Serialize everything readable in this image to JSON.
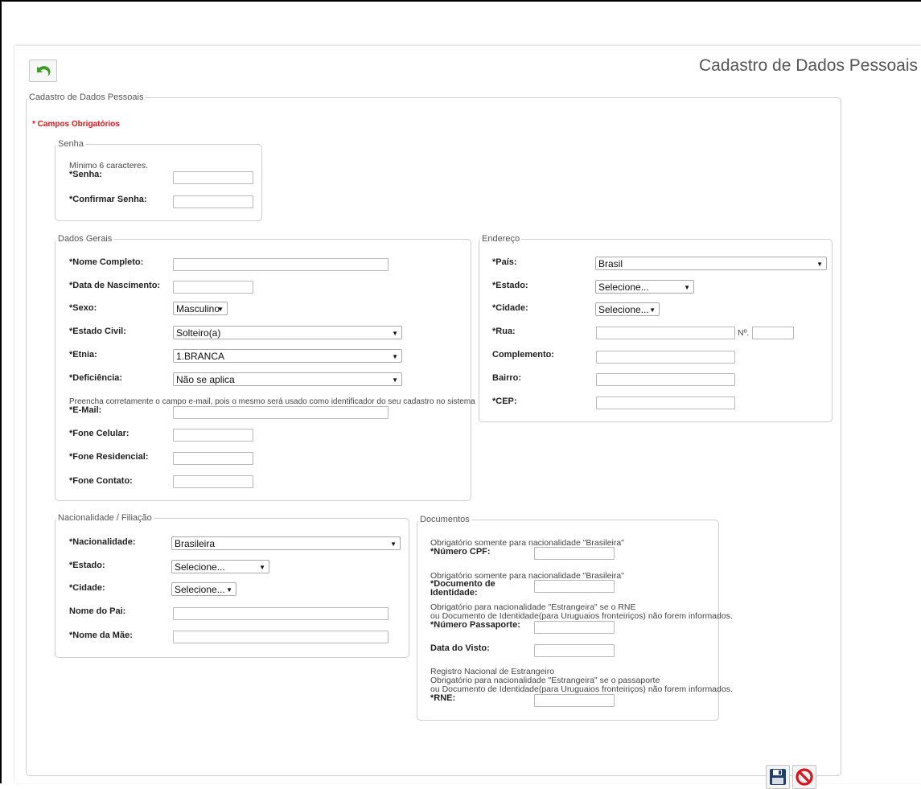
{
  "page_title": "Cadastro de Dados Pessoais",
  "form_legend": "Cadastro de Dados Pessoais",
  "required_note": "* Campos Obrigatórios",
  "senha": {
    "legend": "Senha",
    "hint": "Mínimo 6 caracteres.",
    "senha_label": "*Senha:",
    "confirmar_label": "*Confirmar Senha:"
  },
  "dados_gerais": {
    "legend": "Dados Gerais",
    "nome_label": "*Nome Completo:",
    "nascimento_label": "*Data de Nascimento:",
    "sexo_label": "*Sexo:",
    "sexo_value": "Masculino",
    "estado_civil_label": "*Estado Civil:",
    "estado_civil_value": "Solteiro(a)",
    "etnia_label": "*Etnia:",
    "etnia_value": "1.BRANCA",
    "deficiencia_label": "*Deficiência:",
    "deficiencia_value": "Não se aplica",
    "email_hint": "Preencha corretamente o campo e-mail, pois o mesmo será usado como identificador do seu cadastro no sistema",
    "email_label": "*E-Mail:",
    "fone_celular_label": "*Fone Celular:",
    "fone_residencial_label": "*Fone Residencial:",
    "fone_contato_label": "*Fone Contato:"
  },
  "endereco": {
    "legend": "Endereço",
    "pais_label": "*País:",
    "pais_value": "Brasil",
    "estado_label": "*Estado:",
    "estado_value": "Selecione...",
    "cidade_label": "*Cidade:",
    "cidade_value": "Selecione...",
    "rua_label": "*Rua:",
    "numero_label": "Nº.",
    "complemento_label": "Complemento:",
    "bairro_label": "Bairro:",
    "cep_label": "*CEP:"
  },
  "nacionalidade": {
    "legend": "Nacionalidade / Filiação",
    "nacionalidade_label": "*Nacionalidade:",
    "nacionalidade_value": "Brasileira",
    "estado_label": "*Estado:",
    "estado_value": "Selecione...",
    "cidade_label": "*Cidade:",
    "cidade_value": "Selecione...",
    "pai_label": "Nome do Pai:",
    "mae_label": "*Nome da Mãe:"
  },
  "documentos": {
    "legend": "Documentos",
    "cpf_hint": "Obrigatório somente para nacionalidade \"Brasileira\"",
    "cpf_label": "*Número CPF:",
    "identidade_hint": "Obrigatório somente para nacionalidade \"Brasileira\"",
    "identidade_label_1": "*Documento de",
    "identidade_label_2": "Identidade:",
    "passaporte_hint_1": "Obrigatório para nacionalidade \"Estrangeira\" se o RNE",
    "passaporte_hint_2": "ou Documento de Identidade(para Uruguaios fronteiriços) não forem informados.",
    "passaporte_label": "*Número Passaporte:",
    "visto_label": "Data do Visto:",
    "rne_hint_1": "Registro Nacional de Estrangeiro",
    "rne_hint_2": "Obrigatório para nacionalidade \"Estrangeira\" se o passaporte",
    "rne_hint_3": "ou Documento de Identidade(para Uruguaios fronteiriços) não forem informados.",
    "rne_label": "*RNE:"
  },
  "icons": {
    "back": "undo-arrow-icon",
    "save": "floppy-disk-icon",
    "cancel": "no-entry-icon"
  },
  "colors": {
    "required_red": "#e8141b",
    "back_green": "#3f9a2a",
    "cancel_red": "#d9141c",
    "save_navy": "#1f3e6b"
  }
}
